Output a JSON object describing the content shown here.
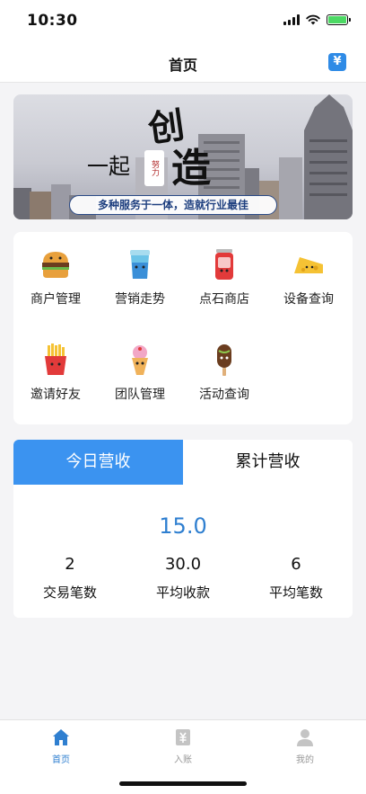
{
  "status_bar": {
    "time": "10:30"
  },
  "nav": {
    "title": "首页",
    "action_icon": "yuan-icon",
    "action_symbol": "¥"
  },
  "banner": {
    "text_yiqi": "一起",
    "text_chuang": "创",
    "text_zao": "造",
    "seal_text": "努力",
    "slogan": "多种服务于一体，造就行业最佳"
  },
  "menu": {
    "items": [
      {
        "label": "商户管理",
        "icon": "burger-icon"
      },
      {
        "label": "营销走势",
        "icon": "drink-cup-icon"
      },
      {
        "label": "点石商店",
        "icon": "soda-can-icon"
      },
      {
        "label": "设备查询",
        "icon": "cheese-icon"
      },
      {
        "label": "邀请好友",
        "icon": "fries-icon"
      },
      {
        "label": "团队管理",
        "icon": "ice-cream-icon"
      },
      {
        "label": "活动查询",
        "icon": "popsicle-icon"
      }
    ]
  },
  "revenue": {
    "tabs": [
      "今日营收",
      "累计营收"
    ],
    "active_tab": 0,
    "total": "15.0",
    "stats": [
      {
        "value": "2",
        "label": "交易笔数"
      },
      {
        "value": "30.0",
        "label": "平均收款"
      },
      {
        "value": "6",
        "label": "平均笔数"
      }
    ]
  },
  "tab_bar": {
    "items": [
      {
        "label": "首页",
        "icon": "home-icon",
        "active": true
      },
      {
        "label": "入账",
        "icon": "receipt-icon",
        "active": false
      },
      {
        "label": "我的",
        "icon": "user-icon",
        "active": false
      }
    ]
  },
  "colors": {
    "accent": "#3b93f0",
    "accent_text": "#2f7fd0",
    "battery": "#4cd964"
  }
}
